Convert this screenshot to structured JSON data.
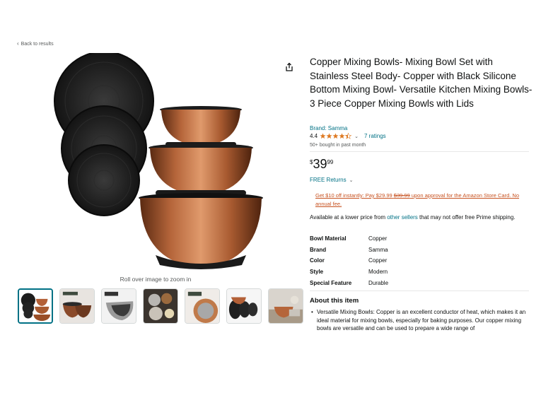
{
  "nav": {
    "back_label": "Back to results"
  },
  "gallery": {
    "zoom_hint": "Roll over image to zoom in",
    "thumbnails": [
      {
        "alt": "bowls-with-lids"
      },
      {
        "alt": "stainless-interior"
      },
      {
        "alt": "silicone-bottom"
      },
      {
        "alt": "food-prep"
      },
      {
        "alt": "copper-rim"
      },
      {
        "alt": "bowls-lids-side"
      },
      {
        "alt": "kitchen-scene"
      }
    ]
  },
  "product": {
    "title": "Copper Mixing Bowls- Mixing Bowl Set with Stainless Steel Body- Copper with Black Silicone Bottom Mixing Bowl- Versatile Kitchen Mixing Bowls- 3 Piece Copper Mixing Bowls with Lids",
    "brand": "Brand: Samma",
    "rating_value": "4.4",
    "rating_stars": 4.4,
    "rating_count": "7 ratings",
    "bought": "50+ bought in past month",
    "price_symbol": "$",
    "price_whole": "39",
    "price_fraction": "99",
    "returns": "FREE Returns",
    "promo_a": "Get $10 off instantly: Pay ",
    "promo_new": "$29.99",
    "promo_b": " ",
    "promo_old": "$39.99",
    "promo_c": " upon approval for the Amazon Store Card. No annual fee.",
    "avail_a": "Available at a lower price from ",
    "avail_link": "other sellers",
    "avail_b": " that may not offer free Prime shipping."
  },
  "specs": [
    {
      "key": "Bowl Material",
      "value": "Copper"
    },
    {
      "key": "Brand",
      "value": "Samma"
    },
    {
      "key": "Color",
      "value": "Copper"
    },
    {
      "key": "Style",
      "value": "Modern"
    },
    {
      "key": "Special Feature",
      "value": "Durable"
    }
  ],
  "about": {
    "heading": "About this item",
    "bullet": "•",
    "text": "Versatile Mixing Bowls: Copper is an excellent conductor of heat, which makes it an ideal material for mixing bowls, especially for baking purposes. Our copper mixing bowls are versatile and can be used to prepare a wide range of"
  },
  "colors": {
    "link": "#007185",
    "promo": "#c7511f",
    "star": "#de7921",
    "copper": "#a0522d"
  }
}
